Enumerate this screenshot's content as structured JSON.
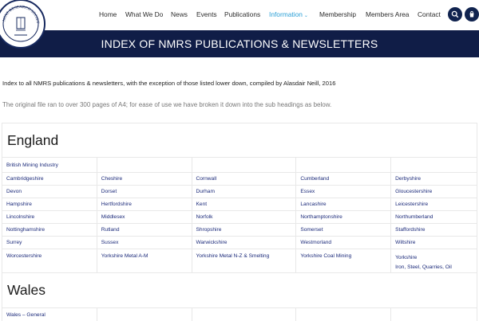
{
  "header": {
    "logo_text": "MINE RESEARCH SOCIETY",
    "nav": [
      {
        "label": "Home",
        "active": false
      },
      {
        "label": "What We Do",
        "active": false
      },
      {
        "label": "News",
        "active": false
      },
      {
        "label": "Events",
        "active": false
      },
      {
        "label": "Publications",
        "active": false
      },
      {
        "label": "Information",
        "active": true,
        "caret": "⌄"
      },
      {
        "label": "Membership",
        "active": false
      },
      {
        "label": "Members Area",
        "active": false
      },
      {
        "label": "Contact",
        "active": false
      }
    ],
    "icons": [
      "search-icon",
      "cart-icon"
    ]
  },
  "banner": {
    "title": "INDEX OF NMRS PUBLICATIONS & NEWSLETTERS"
  },
  "intro": "Index to all NMRS publications & newsletters, with the exception of those listed lower down, compiled by Alasdair Neill, 2016",
  "note": "The original file ran to over 300 pages of A4; for ease of use we have broken it down into the sub headings as below.",
  "england": {
    "heading": "England",
    "rows": [
      [
        "British Mining Industry",
        "",
        "",
        "",
        ""
      ],
      [
        "Cambridgeshire",
        "Cheshire",
        "Cornwall",
        "Cumberland",
        "Derbyshire"
      ],
      [
        "Devon",
        "Dorset",
        "Durham",
        "Essex",
        "Gloucestershire"
      ],
      [
        "Hampshire",
        "Hertfordshire",
        "Kent",
        "Lancashire",
        "Leicestershire"
      ],
      [
        "Lincolnshire",
        "Middlesex",
        "Norfolk",
        "Northamptonshire",
        "Northumberland"
      ],
      [
        "Nottinghamshire",
        "Rutland",
        "Shropshire",
        "Somerset",
        "Staffordshire"
      ],
      [
        "Surrey",
        "Sussex",
        "Warwickshire",
        "Westmorland",
        "Wiltshire"
      ],
      [
        "Worcestershire",
        "Yorkshire Metal A-M",
        "Yorkshire Metal N-Z & Smelting",
        "Yorkshire Coal Mining",
        "Yorkshire"
      ]
    ],
    "last_row_extra": "Iron, Steel, Quarries, Oil"
  },
  "wales": {
    "heading": "Wales",
    "rows": [
      [
        "Wales – General",
        "",
        "",
        "",
        ""
      ]
    ]
  },
  "colors": {
    "navy": "#101d47",
    "link": "#1b2a7a",
    "active": "#2a9fd6"
  }
}
